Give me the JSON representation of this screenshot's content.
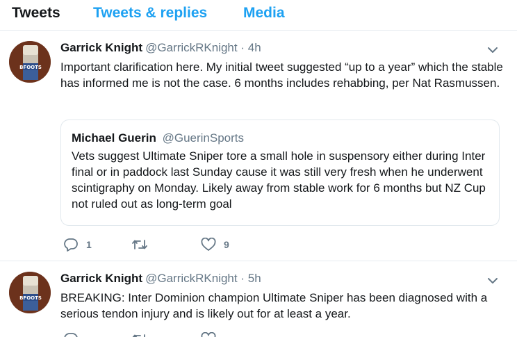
{
  "tabs": [
    {
      "label": "Tweets"
    },
    {
      "label": "Tweets & replies"
    },
    {
      "label": "Media"
    }
  ],
  "tweets": [
    {
      "author": "Garrick Knight",
      "handle": "@GarrickRKnight",
      "separator": "·",
      "time": "4h",
      "text": "Important clarification here. My initial tweet suggested “up to a year” which the stable has informed me is not the case. 6 months includes rehabbing, per Nat Rasmussen.",
      "quote": {
        "author": "Michael Guerin",
        "handle": "@GuerinSports",
        "text": "Vets suggest Ultimate Sniper tore a small hole in suspensory either during Inter final or in paddock last Sunday cause it was still very fresh when he underwent scintigraphy on Monday. Likely away from stable work for 6 months but NZ Cup not ruled out as long-term goal"
      },
      "reply_count": "1",
      "retweet_count": "",
      "like_count": "9"
    },
    {
      "author": "Garrick Knight",
      "handle": "@GarrickRKnight",
      "separator": "·",
      "time": "5h",
      "text": "BREAKING: Inter Dominion champion Ultimate Sniper has been diagnosed with a serious tendon injury and is likely out for at least a year."
    }
  ],
  "colors": {
    "accent": "#1da1f2",
    "text": "#14171a",
    "muted": "#657786",
    "border": "#e6ecf0"
  },
  "icons": {
    "reply": "reply-icon",
    "retweet": "retweet-icon",
    "like": "heart-icon",
    "menu": "chevron-down-icon",
    "avatar": "avatar"
  }
}
